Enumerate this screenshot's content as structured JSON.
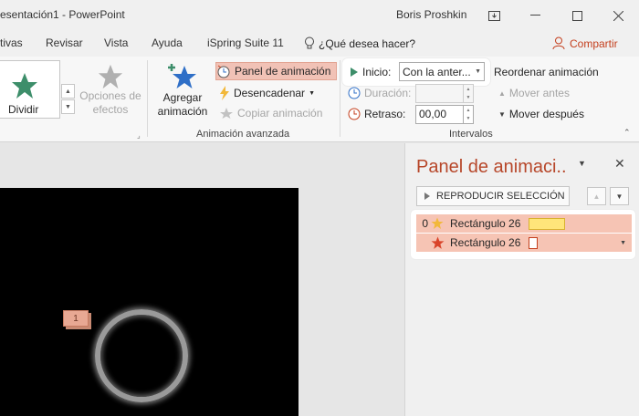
{
  "titlebar": {
    "doc_title": "esentación1  -  PowerPoint",
    "user": "Boris Proshkin",
    "restore_glyph": "⊡",
    "min_glyph": "—",
    "max_glyph": "☐",
    "close_glyph": "✕"
  },
  "menu": {
    "items": [
      "tivas",
      "Revisar",
      "Vista",
      "Ayuda",
      "iSpring Suite 11"
    ],
    "tell_me": "¿Qué desea hacer?",
    "share": "Compartir"
  },
  "ribbon": {
    "dividir": "Dividir",
    "opciones": [
      "Opciones de",
      "efectos"
    ],
    "agregar": [
      "Agregar",
      "animación"
    ],
    "panel_animacion": "Panel de animación",
    "desencadenar": "Desencadenar",
    "copiar_animacion": "Copiar animación",
    "group_advanced": "Animación avanzada",
    "inicio_label": "Inicio:",
    "inicio_value": "Con la anter...",
    "duracion_label": "Duración:",
    "duracion_value": "",
    "retraso_label": "Retraso:",
    "retraso_value": "00,00",
    "group_timing": "Intervalos",
    "reordenar": "Reordenar animación",
    "mover_antes": "Mover antes",
    "mover_despues": "Mover después"
  },
  "slide": {
    "anim_number": "1"
  },
  "pane": {
    "title": "Panel de animaci..",
    "play_label": "REPRODUCIR SELECCIÓN",
    "items": [
      {
        "index": "0",
        "name": "Rectángulo 26",
        "bar_color": "#ffe57a",
        "icon_color": "#f2b83a"
      },
      {
        "index": "",
        "name": "Rectángulo 26",
        "bar_color": "#ffffff",
        "icon_color": "#d9442a"
      }
    ]
  },
  "colors": {
    "accent": "#b7472a",
    "selection": "#f1c2b6",
    "star_green": "#3d8e6a",
    "star_blue": "#2f6fc7"
  }
}
